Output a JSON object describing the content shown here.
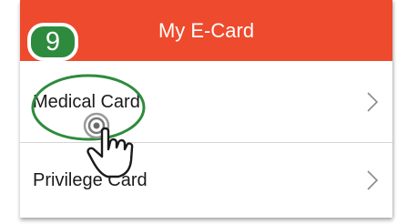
{
  "header": {
    "title": "My E-Card",
    "background_color": "#ee4a2d"
  },
  "step_badge": {
    "number": "9",
    "color": "#2e8b3e"
  },
  "cards": [
    {
      "label": "Medical Card",
      "icon": "chevron-right-icon"
    },
    {
      "label": "Privilege Card",
      "icon": "chevron-right-icon"
    }
  ],
  "annotations": {
    "highlight_color": "#2e8b3e",
    "cursor_icon": "hand-tap-icon"
  }
}
